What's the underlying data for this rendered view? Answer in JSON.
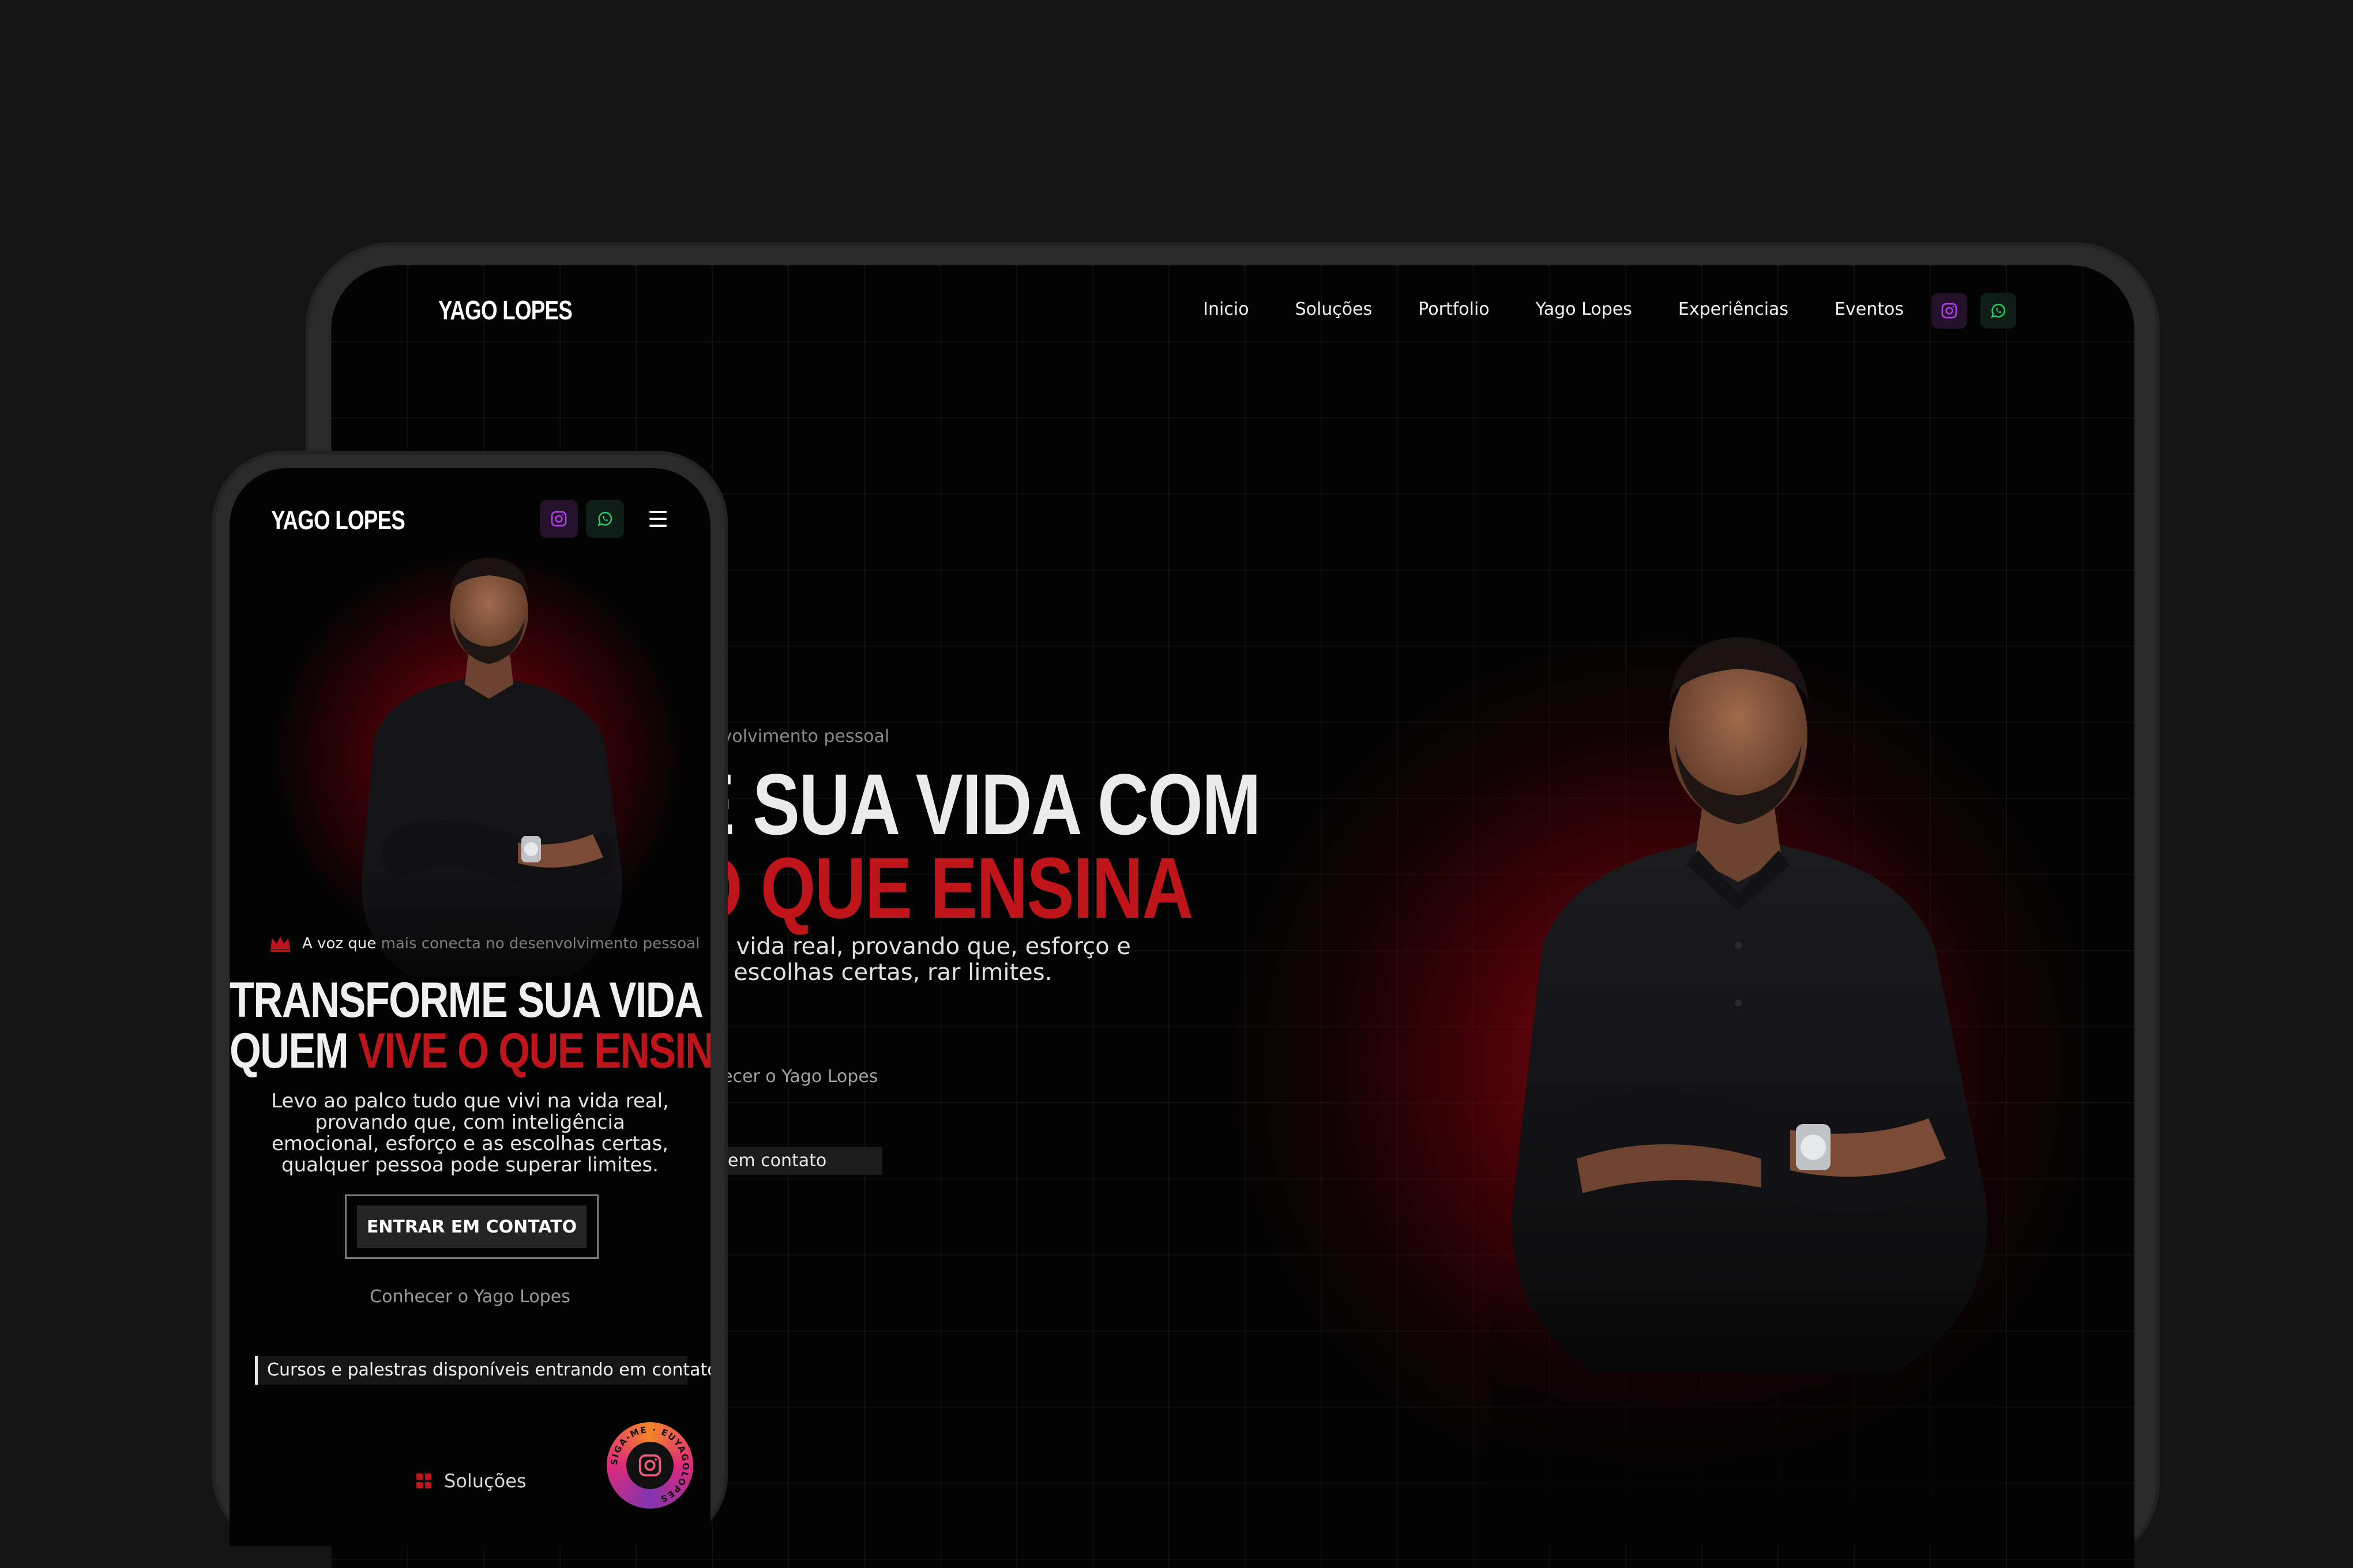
{
  "desktop": {
    "brand": "YAGO LOPES",
    "nav": [
      "Inicio",
      "Soluções",
      "Portfolio",
      "Yago Lopes",
      "Experiências",
      "Eventos"
    ],
    "hero": {
      "eyebrow": "envolvimento pessoal",
      "line1": "E SUA VIDA COM",
      "line2": "O QUE ENSINA",
      "paragraph": "na vida real, provando que, esforço e as escolhas certas, rar limites.",
      "link": "nhecer o Yago Lopes",
      "contact": "o em contato"
    }
  },
  "mobile": {
    "brand": "YAGO LOPES",
    "tagline_lead": "A voz que",
    "tagline_rest": "mais conecta no desenvolvimento pessoal",
    "headline_line1": "TRANSFORME SUA VIDA COM",
    "headline_line2_a": "QUEM",
    "headline_line2_b": "VIVE O QUE ENSINA",
    "paragraph": "Levo ao palco tudo que vivi na vida real, provando que, com inteligência emocional, esforço e as escolhas certas, qualquer pessoa pode superar limites.",
    "cta": "ENTRAR EM CONTATO",
    "link": "Conhecer o Yago Lopes",
    "note": "Cursos e palestras disponíveis entrando em contato",
    "bottom_nav": "Soluções",
    "badge_text": "SIGA-ME · EUYAGOLOPES"
  },
  "colors": {
    "accent_red": "#c0141b",
    "instagram": "#b43cf0",
    "whatsapp": "#25d366",
    "background": "#141415"
  },
  "icons": [
    "instagram-icon",
    "whatsapp-icon",
    "menu-icon",
    "crown-icon",
    "grid-icon"
  ]
}
